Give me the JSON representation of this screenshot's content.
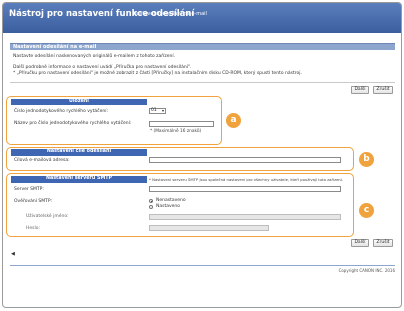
{
  "header": {
    "title": "Nástroj pro nastavení funkce odesílání",
    "subtitle": "Nastavení odesílání na e-mail"
  },
  "page": {
    "bar_title": "Nastavení odesílání na e-mail",
    "desc1": "Nastavte odesílání naskenovaných originálů e-mailem z tohoto zařízení.",
    "desc2": "Další podrobné informace o nastavení uvádí „Příručka pro nastavení odesílání\".",
    "desc3": "* „Příručku pro nastavení odesílání\" je možné zobrazit z části [Příručky] na instalačním disku CD-ROM, který spustí tento nástroj.",
    "next_label": "Další",
    "cancel_label": "Zrušit"
  },
  "sections": {
    "save": {
      "title": "Uložení",
      "speed_dial_label": "Číslo jednodotykového rychlého vytáčení:",
      "speed_dial_value": "01",
      "name_label": "Název pro číslo jednodotykového rychlého vytáčení:",
      "name_value": "",
      "max_note": "* (Maximálně 16 znaků)"
    },
    "dest": {
      "title": "Nastavení cíle odesílání",
      "email_label": "Cílová e-mailová adresa:",
      "email_value": ""
    },
    "smtp": {
      "title": "Nastavení serveru SMTP",
      "note": "* Nastavení serveru SMTP jsou společná nastavení pro všechny uživatele, kteří používají tuto zařízení.",
      "server_label": "Server SMTP:",
      "server_value": "",
      "auth_label": "Ověřování SMTP:",
      "auth_options": [
        "Nenastaveno",
        "Nastaveno"
      ],
      "username_label": "Uživatelské jméno:",
      "password_label": "Heslo:"
    }
  },
  "callouts": [
    "a",
    "b",
    "c"
  ],
  "footer": {
    "back_glyph": "◀",
    "copyright": "Copyright CANON INC. 2016"
  },
  "colors": {
    "header": "#3b5f9e",
    "section_header": "#3f66b3",
    "callout": "#f0a23c"
  }
}
